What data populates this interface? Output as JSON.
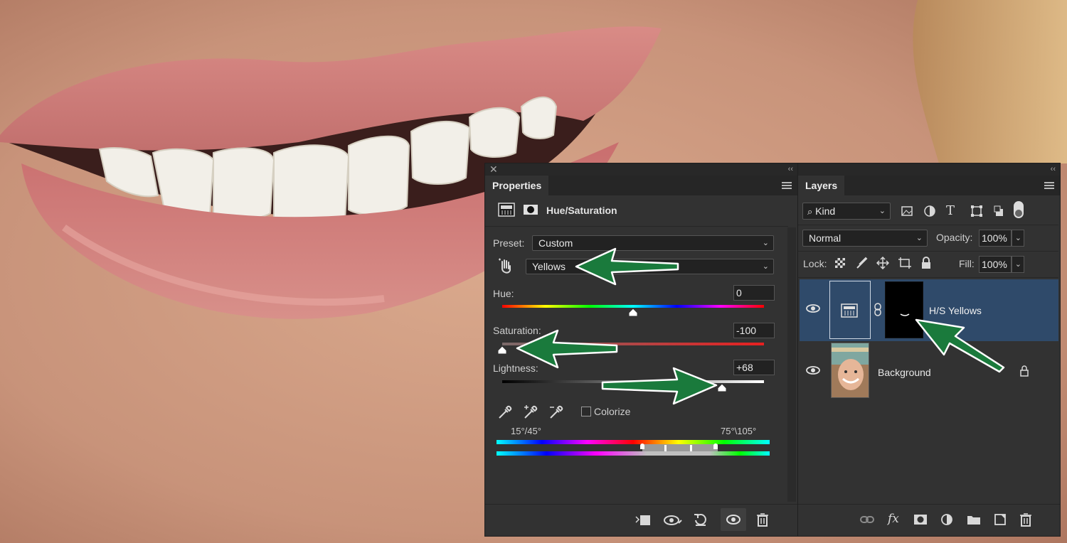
{
  "properties": {
    "tab_label": "Properties",
    "adjustment_title": "Hue/Saturation",
    "preset_label": "Preset:",
    "preset_value": "Custom",
    "channel_value": "Yellows",
    "hue_label": "Hue:",
    "hue_value": "0",
    "hue_level": 0,
    "saturation_label": "Saturation:",
    "saturation_value": "-100",
    "saturation_level": -100,
    "lightness_label": "Lightness:",
    "lightness_value": "+68",
    "lightness_level": 68,
    "colorize_label": "Colorize",
    "range_left": "15°/45°",
    "range_right": "75°\\105°",
    "bottom_icons": [
      "clip-to-layer-icon",
      "view-previous-icon",
      "reset-icon",
      "visibility-icon",
      "delete-icon"
    ]
  },
  "layers": {
    "tab_label": "Layers",
    "filter_kind": "Kind",
    "blend_mode": "Normal",
    "opacity_label": "Opacity:",
    "opacity_value": "100%",
    "lock_label": "Lock:",
    "fill_label": "Fill:",
    "fill_value": "100%",
    "items": [
      {
        "name": "H/S Yellows",
        "selected": true
      },
      {
        "name": "Background",
        "selected": false
      }
    ]
  },
  "colors": {
    "panel_bg": "#323232",
    "selected_row": "#2f4a6a",
    "arrow_green": "#1a7a3c"
  }
}
